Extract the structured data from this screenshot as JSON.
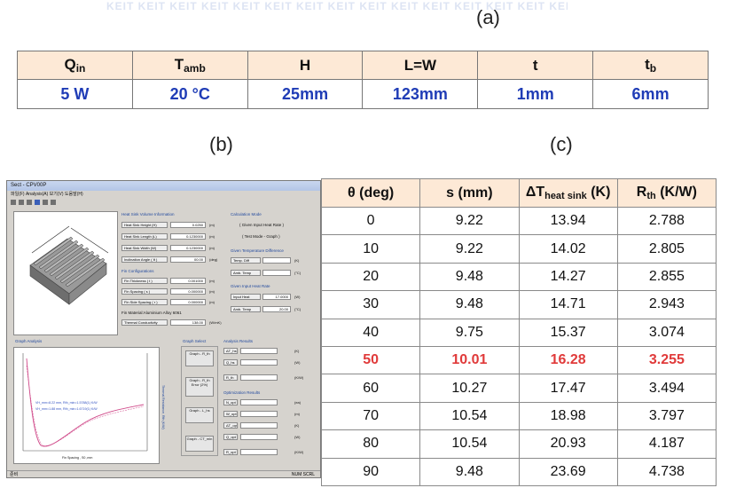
{
  "captions": {
    "a": "(a)",
    "b": "(b)",
    "c": "(c)"
  },
  "watermark": "KEIT KEIT KEIT KEIT KEIT KEIT KEIT KEIT KEIT KEIT KEIT KEIT KEIT KEIT KEIT KEIT KEIT",
  "table1": {
    "headers": [
      {
        "main": "Q",
        "sub": "in"
      },
      {
        "main": "T",
        "sub": "amb"
      },
      {
        "main": "H",
        "sub": ""
      },
      {
        "main": "L=W",
        "sub": ""
      },
      {
        "main": "t",
        "sub": ""
      },
      {
        "main": "t",
        "sub": "b"
      }
    ],
    "values": [
      "5 W",
      "20 °C",
      "25mm",
      "123mm",
      "1mm",
      "6mm"
    ]
  },
  "app": {
    "title": "Sect - CPV00P",
    "menu": "파일(F)   Analysis(A)   보기(V)   도움말(H)",
    "status_left": "준비",
    "status_right": "NUM  SCRL",
    "volume_group": "Heat Sink Volume Information",
    "volume_rows": [
      {
        "label": "Heat Sink Height (H)",
        "value": "0.0250",
        "unit": "(m)"
      },
      {
        "label": "Heat Sink Length (L)",
        "value": "0.1230000",
        "unit": "(m)"
      },
      {
        "label": "Heat Sink Width (W)",
        "value": "0.1230000",
        "unit": "(m)"
      },
      {
        "label": "Inclination Angle ( θ )",
        "value": "00.00",
        "unit": "(deg)"
      }
    ],
    "fin_group": "Fin Configurations",
    "fin_rows": [
      {
        "label": "Fin Thickness ( t )",
        "value": "0.001000",
        "unit": "(m)"
      },
      {
        "label": "Fin Spacing ( s )",
        "value": "0.000000",
        "unit": "(m)"
      },
      {
        "label": "Fin Side Spacing ( r )",
        "value": "0.000000",
        "unit": "(m)"
      }
    ],
    "material": "Fin Material:Aluminium Alloy 6061",
    "conductivity": {
      "label": "Thermal Conductivity",
      "value": "138.00",
      "unit": "(W/mK)"
    },
    "calc_group": "Calculation Mode",
    "calc_lines": [
      "( Given Input Heat Rate )",
      "( Test Mode - Graph )"
    ],
    "temp_group": "Given Temperature Difference",
    "temp_rows": [
      {
        "label": "Temp. Diff",
        "unit": "(K)"
      },
      {
        "label": "Amb. Temp",
        "unit": "(°C)"
      }
    ],
    "heat_group": "Given Input Heat Rate",
    "heat_rows": [
      {
        "label": "Input Heat",
        "value": "17.0000",
        "unit": "(W)"
      },
      {
        "label": "Amb. Temp",
        "value": "20.00",
        "unit": "(°C)"
      }
    ],
    "graph_group": "Graph Analysis",
    "graph_xlabel": "Fin Spacing , S0 ,mm",
    "graph_ylabel": "Thermal Resistance, Rth (K/W)",
    "graph_notes": [
      "VH_mm=8.22 mm,  Rth_min=1.5788(1) K/W",
      "VH_mm=1.88 mm,  Rth_min=1.6719(1) K/W"
    ],
    "select_group": "Graph Select",
    "select_buttons": [
      "Graph - R_th",
      "Graph - R_th Error (2%)",
      "Graph - L_hs",
      "Graph - CT_min"
    ],
    "results_group": "Analysis Results",
    "results_rows": [
      {
        "label": "ΔT_hs",
        "unit": "(K)"
      },
      {
        "label": "Q_hs",
        "unit": "(W)"
      },
      {
        "label": "R_th",
        "unit": "(K/W)"
      }
    ],
    "opt_group": "Optimization Results",
    "opt_rows": [
      {
        "label": "N_opt",
        "unit": "(ea)"
      },
      {
        "label": "W_opt",
        "unit": "(m)"
      },
      {
        "label": "ΔT_opt",
        "unit": "(K)"
      },
      {
        "label": "Q_opt",
        "unit": "(W)"
      },
      {
        "label": "R_opt",
        "unit": "(K/W)"
      }
    ]
  },
  "table2": {
    "headers": [
      {
        "main": "θ (deg)",
        "sub": ""
      },
      {
        "main": "s (mm)",
        "sub": ""
      },
      {
        "main": "ΔT",
        "sub": "heat sink",
        "tail": " (K)"
      },
      {
        "main": "R",
        "sub": "th",
        "tail": " (K/W)"
      }
    ],
    "highlight_row": 5,
    "highlight_color": "#e03a3a",
    "rows": [
      [
        "0",
        "9.22",
        "13.94",
        "2.788"
      ],
      [
        "10",
        "9.22",
        "14.02",
        "2.805"
      ],
      [
        "20",
        "9.48",
        "14.27",
        "2.855"
      ],
      [
        "30",
        "9.48",
        "14.71",
        "2.943"
      ],
      [
        "40",
        "9.75",
        "15.37",
        "3.074"
      ],
      [
        "50",
        "10.01",
        "16.28",
        "3.255"
      ],
      [
        "60",
        "10.27",
        "17.47",
        "3.494"
      ],
      [
        "70",
        "10.54",
        "18.98",
        "3.797"
      ],
      [
        "80",
        "10.54",
        "20.93",
        "4.187"
      ],
      [
        "90",
        "9.48",
        "23.69",
        "4.738"
      ]
    ]
  },
  "colors": {
    "header_bg": "#fde9d6",
    "value_blue": "#1f3cb6",
    "curve": "#d04a8a"
  }
}
